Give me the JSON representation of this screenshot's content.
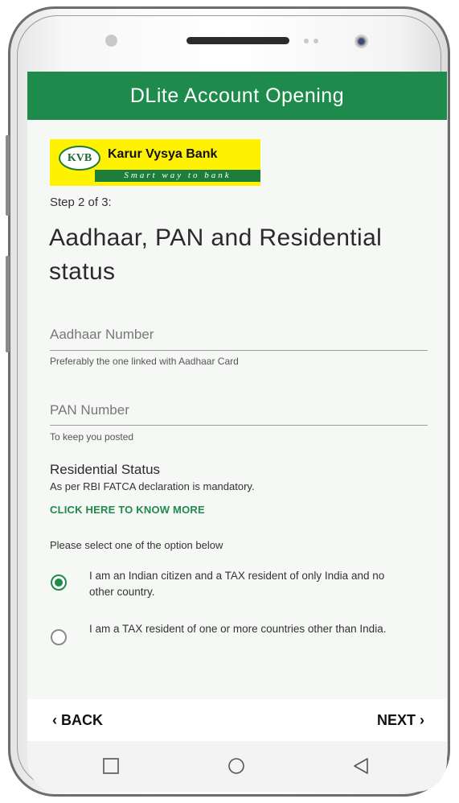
{
  "app": {
    "title": "DLite Account Opening"
  },
  "logo": {
    "emblem": "KVB",
    "name": "Karur Vysya Bank",
    "tagline": "Smart way to bank"
  },
  "step": "Step 2 of 3:",
  "page_title": "Aadhaar, PAN and Residential status",
  "aadhaar": {
    "placeholder": "Aadhaar Number",
    "help": "Preferably the one linked with Aadhaar Card"
  },
  "pan": {
    "placeholder": "PAN Number",
    "help": "To keep you posted"
  },
  "residential": {
    "title": "Residential Status",
    "subtitle": "As per RBI FATCA declaration is mandatory.",
    "link": "CLICK HERE TO KNOW MORE",
    "prompt": "Please select one of the option below",
    "options": [
      {
        "label": "I am an Indian citizen and a TAX resident of only India and no other country.",
        "selected": true
      },
      {
        "label": "I am a TAX resident of one or more countries other than India.",
        "selected": false
      }
    ]
  },
  "footer": {
    "back_label": "BACK",
    "next_label": "NEXT"
  },
  "nav": {
    "icons": [
      "recent-apps-icon",
      "home-icon",
      "back-icon"
    ]
  },
  "colors": {
    "brand_green": "#1e8a4c",
    "logo_yellow": "#fff200"
  }
}
